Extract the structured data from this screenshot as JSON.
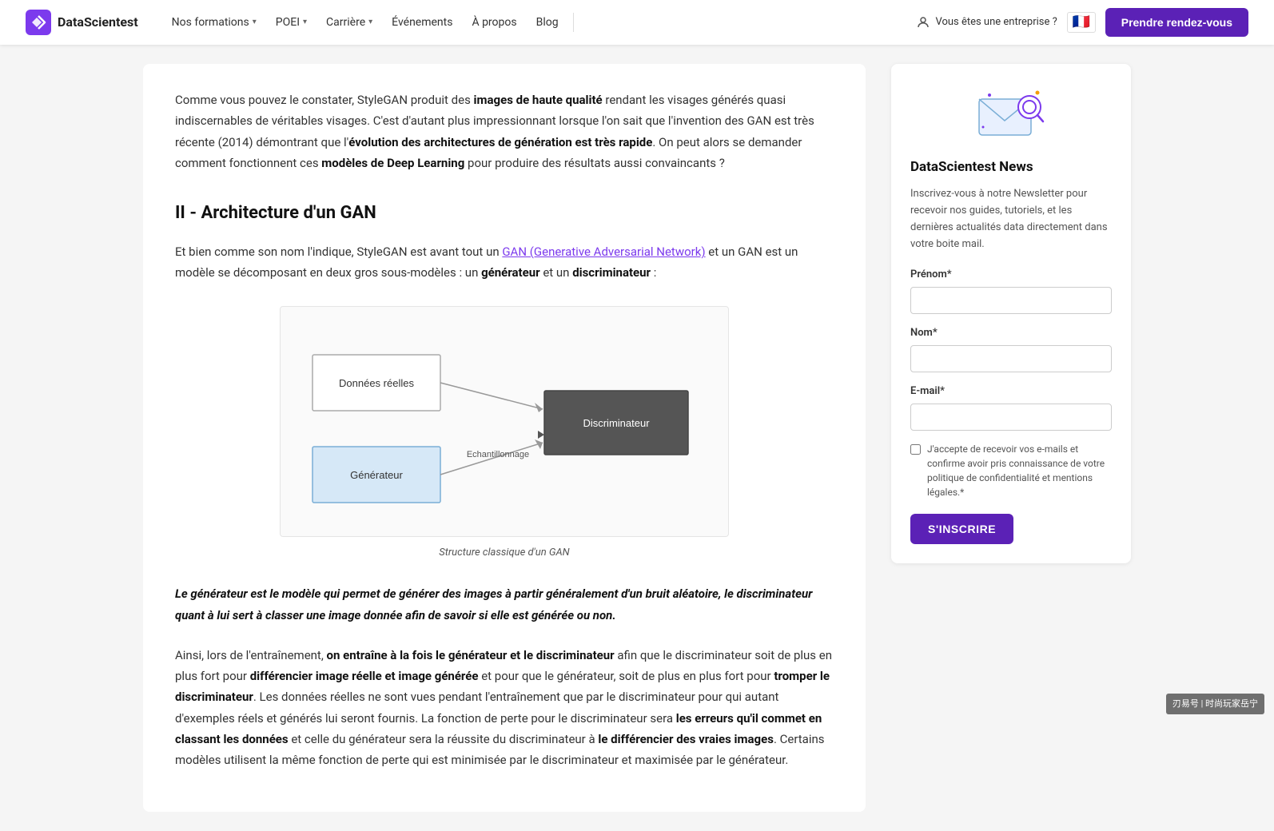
{
  "navbar": {
    "logo_text": "DataScientest",
    "nav_items": [
      {
        "label": "Nos formations",
        "has_dropdown": true
      },
      {
        "label": "POEI",
        "has_dropdown": true
      },
      {
        "label": "Carrière",
        "has_dropdown": true
      },
      {
        "label": "Événements",
        "has_dropdown": false
      },
      {
        "label": "À propos",
        "has_dropdown": false
      },
      {
        "label": "Blog",
        "has_dropdown": false
      }
    ],
    "enterprise_label": "Vous êtes une entreprise ?",
    "flag_emoji": "🇫🇷",
    "cta_label": "Prendre rendez-vous"
  },
  "article": {
    "paragraph1": "Comme vous pouvez le constater, StyleGAN produit des ",
    "paragraph1_bold1": "images de haute qualité",
    "paragraph1_rest": " rendant les visages générés quasi indiscernables de véritables visages. C'est d'autant plus impressionnant lorsque l'on sait que l'invention des GAN est très récente (2014) démontrant que l'",
    "paragraph1_bold2": "évolution des architectures de génération est très rapide",
    "paragraph1_end": ". On peut alors se demander comment fonctionnent ces ",
    "paragraph1_bold3": "modèles de Deep Learning",
    "paragraph1_final": " pour produire des résultats aussi convaincants ?",
    "section_heading": "II - Architecture d'un GAN",
    "paragraph2_start": "Et bien comme son nom l'indique, StyleGAN est avant tout un ",
    "paragraph2_link": "GAN (Generative Adversarial Network)",
    "paragraph2_rest": " et un GAN est un modèle se décomposant en deux gros sous-modèles : un ",
    "paragraph2_bold1": "générateur",
    "paragraph2_mid": " et un ",
    "paragraph2_bold2": "discriminateur",
    "paragraph2_end": " :",
    "diagram_caption": "Structure classique d'un GAN",
    "diagram": {
      "box_donnees_label": "Données réelles",
      "box_generateur_label": "Générateur",
      "box_discriminateur_label": "Discriminateur",
      "arrow_label": "Echantillonnage"
    },
    "callout": "Le générateur est le modèle qui permet de générer des images à partir généralement d'un bruit aléatoire, le discriminateur quant à lui sert à classer une image donnée afin de savoir si elle est générée ou non.",
    "paragraph3_start": "Ainsi, lors de l'entraînement, ",
    "paragraph3_bold1": "on entraîne à la fois le générateur et le discriminateur",
    "paragraph3_rest": " afin que le discriminateur soit de plus en plus fort pour ",
    "paragraph3_bold2": "différencier image réelle et image générée",
    "paragraph3_rest2": " et pour que le générateur, soit de plus en plus fort pour ",
    "paragraph3_bold3": "tromper le discriminateur",
    "paragraph3_rest3": ". Les données réelles ne sont vues pendant l'entraînement que par le discriminateur pour qui autant d'exemples réels et générés lui seront fournis. La fonction de perte pour le discriminateur sera ",
    "paragraph3_bold4": "les erreurs qu'il commet en classant les données",
    "paragraph3_rest4": " et celle du générateur sera la réussite du discriminateur à ",
    "paragraph3_bold5": "le différencier des vraies images",
    "paragraph3_end": ". Certains modèles utilisent la même fonction de perte qui est minimisée par le discriminateur et maximisée par le générateur."
  },
  "sidebar": {
    "newsletter_title": "DataScientest News",
    "newsletter_desc": "Inscrivez-vous à notre Newsletter pour recevoir nos guides, tutoriels, et les dernières actualités data directement dans votre boite mail.",
    "field_prenom_label": "Prénom*",
    "field_prenom_placeholder": "",
    "field_nom_label": "Nom*",
    "field_nom_placeholder": "",
    "field_email_label": "E-mail*",
    "field_email_placeholder": "",
    "checkbox_label": "J'accepte de recevoir vos e-mails et confirme avoir pris connaissance de votre politique de confidentialité et mentions légales.*",
    "submit_label": "S'INSCRIRE"
  },
  "watermark": {
    "text": "刃易号 | 时尚玩家岳宁"
  }
}
